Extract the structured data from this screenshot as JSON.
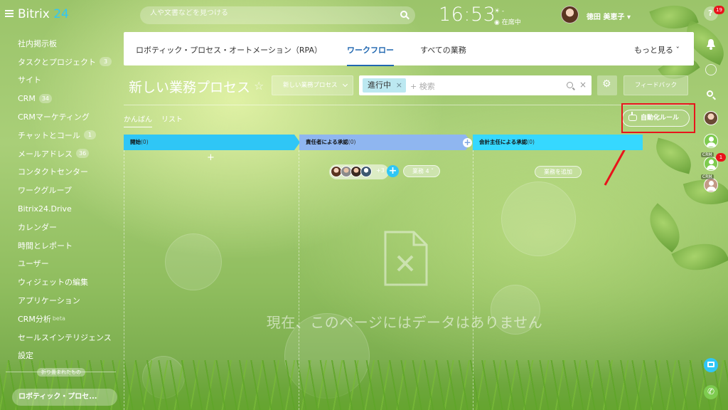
{
  "header": {
    "logo_text": "Bitrix",
    "logo_num": "24",
    "search_placeholder": "人や文書などを見つける",
    "clock": "16:53",
    "clock_status": "在席中",
    "clock_weather": "☀ -",
    "username": "徳田 美恵子",
    "username_chevron": "▾"
  },
  "sidebar": {
    "items": [
      {
        "label": "社内掲示板"
      },
      {
        "label": "タスクとプロジェクト",
        "count": "3"
      },
      {
        "label": "サイト"
      },
      {
        "label": "CRM",
        "count": "34"
      },
      {
        "label": "CRMマーケティング"
      },
      {
        "label": "チャットとコール",
        "count": "1"
      },
      {
        "label": "メールアドレス",
        "count": "36"
      },
      {
        "label": "コンタクトセンター"
      },
      {
        "label": "ワークグループ"
      },
      {
        "label": "Bitrix24.Drive"
      },
      {
        "label": "カレンダー"
      },
      {
        "label": "時間とレポート"
      },
      {
        "label": "ユーザー"
      },
      {
        "label": "ウィジェットの編集"
      },
      {
        "label": "アプリケーション"
      },
      {
        "label": "CRM分析",
        "suffix": "beta"
      },
      {
        "label": "セールスインテリジェンス"
      },
      {
        "label": "設定"
      }
    ],
    "collapsed_label": "折り畳まれたもの",
    "current_app": "ロボティック・プロセ..."
  },
  "tabs": {
    "rpa": "ロボティック・プロセス・オートメーション（RPA）",
    "workflow": "ワークフロー",
    "all_tasks": "すべての業務",
    "more": "もっと見る ˇ"
  },
  "toolbar": {
    "title": "新しい業務プロセス",
    "star": "☆",
    "process_select": "新しい業務プロセス",
    "filter_chip": "進行中",
    "filter_chip_close": "×",
    "filter_placeholder": "+ 検索",
    "filter_clear": "×",
    "gear": "⚙",
    "feedback": "フィードバック"
  },
  "views": {
    "kanban": "かんばん",
    "list": "リスト"
  },
  "automation_button": "自動化ルール",
  "columns": [
    {
      "title": "開始",
      "count": "(0)",
      "color": "#2fc6f6"
    },
    {
      "title": "責任者による承認",
      "count": "(0)",
      "color": "#8fb6f0"
    },
    {
      "title": "会計主任による承認",
      "count": "(0)",
      "color": "#36d8ff"
    }
  ],
  "column_plus": "+",
  "column_add": "+",
  "avatars_more": "+3",
  "avatar_add": "+",
  "tasks_pill": "業務 4 ˇ",
  "add_task": "業務を追加",
  "empty_text": "現在、このページにはデータはありません",
  "right_rail": {
    "help_badge": "19",
    "crm_badge": "1",
    "crm_tag": "CRM",
    "crm_tag2": "CRM"
  },
  "colors": {
    "accent": "#2067b0",
    "highlight": "#e8141b",
    "logo_num": "#2fc6f6"
  }
}
